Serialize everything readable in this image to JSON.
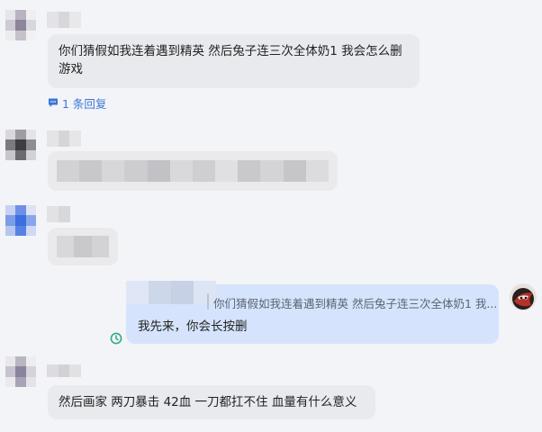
{
  "messages": [
    {
      "text": "你们猜假如我连着遇到精英 然后兔子连三次全体奶1 我会怎么删游戏",
      "reply_count_label": "1 条回复"
    },
    {
      "text": ""
    },
    {
      "text": ""
    },
    {
      "quote": "你们猜假如我连着遇到精英 然后兔子连三次全体奶1 我...",
      "text": "我先来，你会长按删"
    },
    {
      "text": "然后画家 两刀暴击 42血 一刀都扛不住 血量有什么意义"
    }
  ],
  "icons": {
    "reply": "comment-icon",
    "sent_status": "clock-icon",
    "self_avatar": "avatar-image"
  },
  "colors": {
    "background": "#f3f4f7",
    "bubble_other": "#e9eaee",
    "bubble_self": "#d5e4fc",
    "link": "#3b74d8",
    "status": "#2cab8a"
  }
}
